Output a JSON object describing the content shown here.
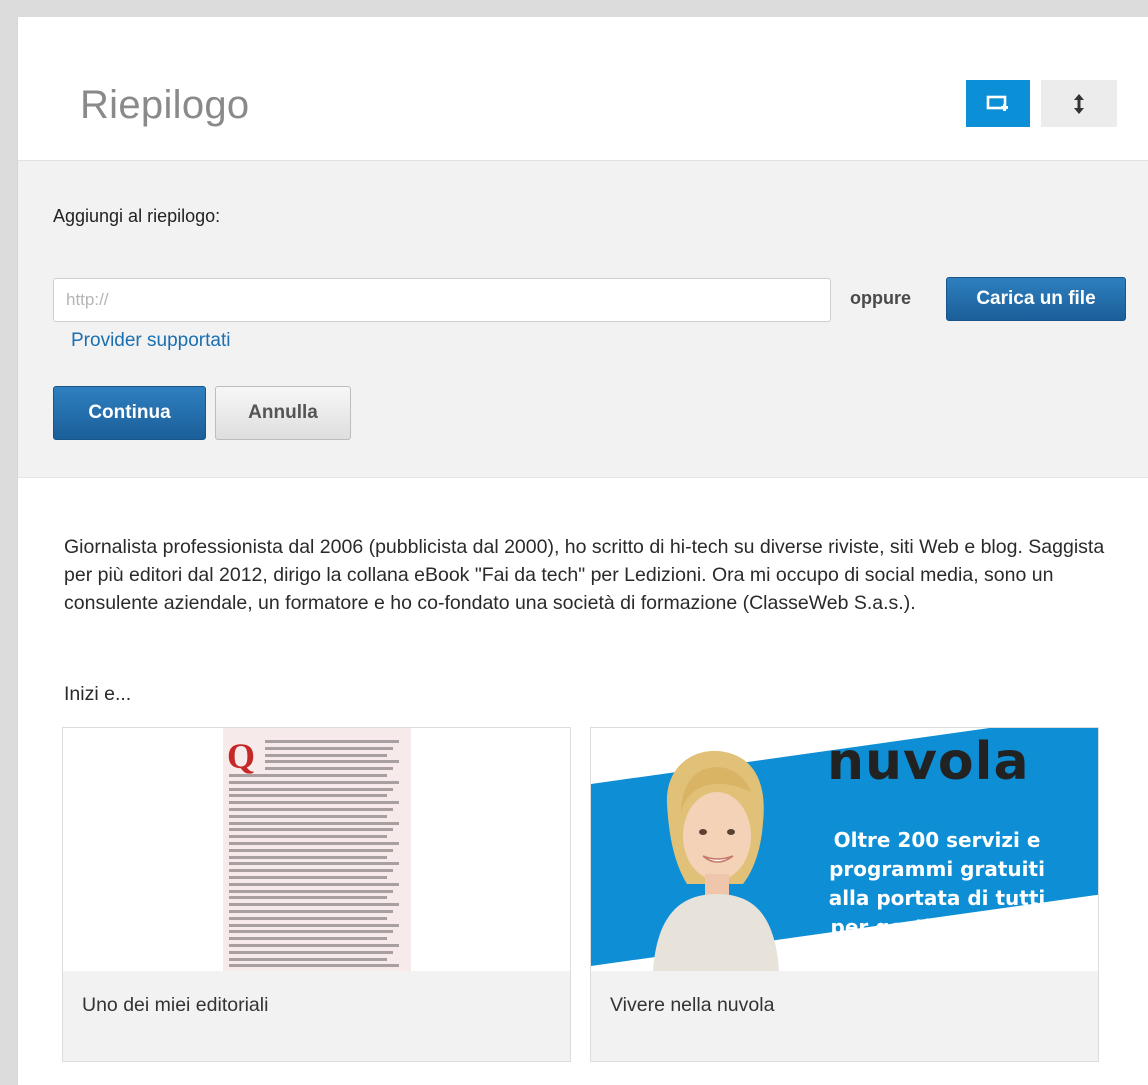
{
  "header": {
    "title": "Riepilogo",
    "view_buttons": [
      {
        "icon": "add-frame-icon",
        "active": true
      },
      {
        "icon": "vertical-resize-icon",
        "active": false
      }
    ]
  },
  "add_form": {
    "label": "Aggiungi al riepilogo:",
    "url_placeholder": "http://",
    "url_value": "",
    "or_text": "oppure",
    "upload_button": "Carica un file",
    "providers_link": "Provider supportati",
    "continue_button": "Continua",
    "cancel_button": "Annulla"
  },
  "summary": {
    "text": "Giornalista professionista dal 2006 (pubblicista dal 2000), ho scritto di hi-tech su diverse riviste, siti Web e blog. Saggista per più editori dal 2012, dirigo la collana eBook \"Fai da tech\" per Ledizioni. Ora mi occupo di social media, sono un consulente aziendale, un formatore e ho co-fondato una società di formazione (ClasseWeb S.a.s.).",
    "intro": "Inizi e..."
  },
  "media": [
    {
      "caption": "Uno dei miei editoriali",
      "thumbnail": {
        "drop_cap": "Q"
      }
    },
    {
      "caption": "Vivere nella nuvola",
      "thumbnail": {
        "heading": "nuvola",
        "subtitle_lines": [
          "Oltre 200 servizi e",
          "programmi gratuiti",
          "alla portata di tutti",
          "per gestire il cloud"
        ]
      }
    }
  ],
  "colors": {
    "accent": "#0b8fd6",
    "primary_button": "#1f67a6",
    "link": "#1a6fb0",
    "form_background": "#f2f2f2"
  }
}
